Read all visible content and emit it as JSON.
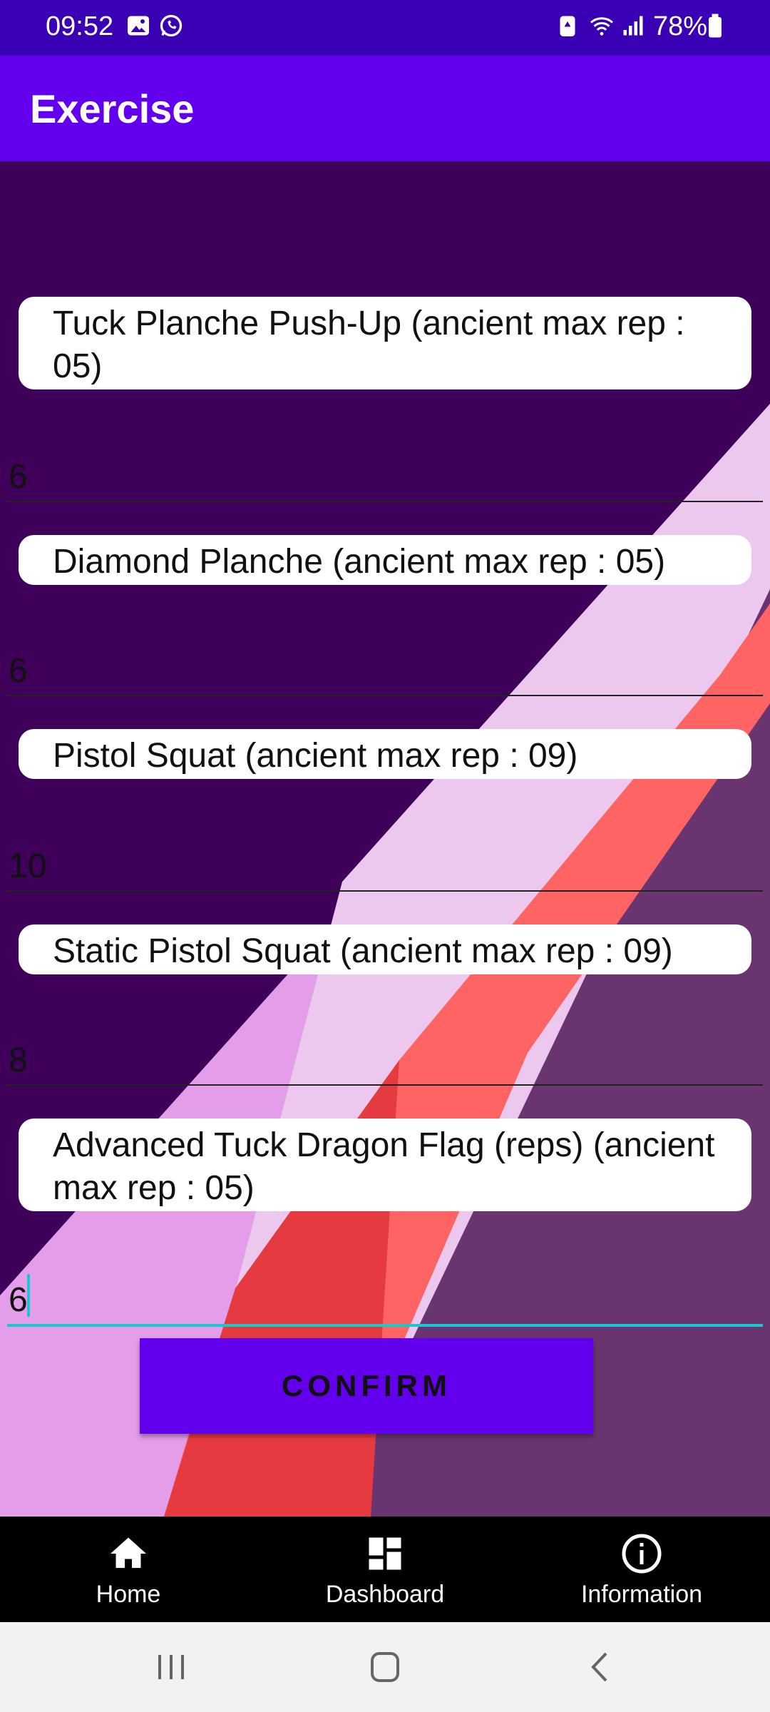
{
  "status_bar": {
    "time": "09:52",
    "battery_percent": "78%",
    "left_icons": [
      "image-icon",
      "whatsapp-icon"
    ],
    "right_icons": [
      "battery-saver-icon",
      "wifi-icon",
      "signal-icon",
      "battery-icon"
    ]
  },
  "app_bar": {
    "title": "Exercise"
  },
  "exercises": [
    {
      "label": "Tuck Planche Push-Up (ancient max rep : 05)",
      "value": "6"
    },
    {
      "label": "Diamond Planche (ancient max rep : 05)",
      "value": "6"
    },
    {
      "label": "Pistol Squat (ancient max rep : 09)",
      "value": "10"
    },
    {
      "label": "Static Pistol Squat (ancient max rep : 09)",
      "value": "8"
    },
    {
      "label": "Advanced Tuck Dragon Flag (reps) (ancient max rep : 05)",
      "value": "6"
    }
  ],
  "confirm_label": "CONFIRM",
  "bottom_nav": [
    {
      "label": "Home",
      "icon": "home-icon"
    },
    {
      "label": "Dashboard",
      "icon": "dashboard-icon"
    },
    {
      "label": "Information",
      "icon": "info-icon"
    }
  ],
  "system_nav": [
    "recent-apps-icon",
    "home-button-icon",
    "back-icon"
  ],
  "colors": {
    "status_bar": "#3a00b4",
    "app_bar": "#6200ee",
    "background": "#3e0058",
    "accent": "#18c8cc",
    "confirm_button": "#6200ee"
  }
}
